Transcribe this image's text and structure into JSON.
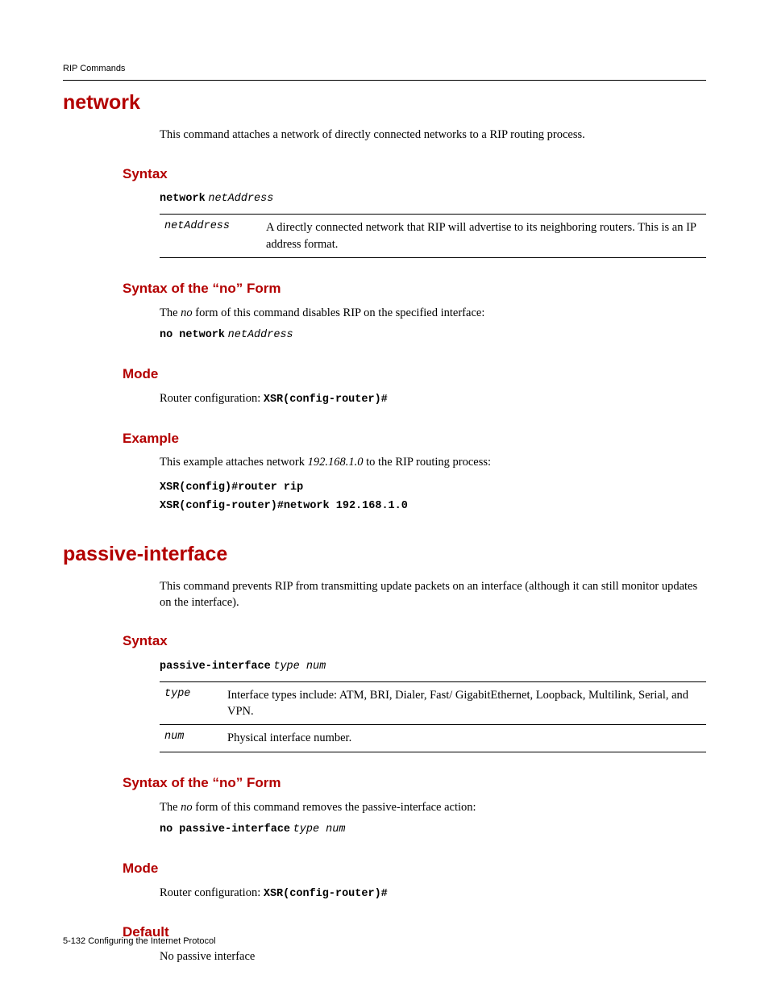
{
  "running_head": "RIP Commands",
  "section1": {
    "title": "network",
    "intro": "This command attaches a network of directly connected networks to a RIP routing process.",
    "syntax_h": "Syntax",
    "syntax_cmd": "network",
    "syntax_arg": "netAddress",
    "param_key": "netAddress",
    "param_desc": "A directly connected network that RIP will advertise to its neighboring routers. This is an IP address format.",
    "noform_h": "Syntax of the “no” Form",
    "noform_lead1": "The ",
    "noform_em": "no",
    "noform_lead2": " form of this command disables RIP on the specified interface:",
    "noform_cmd": "no network",
    "noform_arg": "netAddress",
    "mode_h": "Mode",
    "mode_lead": "Router configuration: ",
    "mode_code": "XSR(config-router)#",
    "example_h": "Example",
    "example_lead1": "This example attaches network ",
    "example_em": "192.168.1.0",
    "example_lead2": " to the RIP routing process:",
    "example_code1": "XSR(config)#router rip",
    "example_code2": "XSR(config-router)#network 192.168.1.0"
  },
  "section2": {
    "title": "passive-interface",
    "intro": "This command prevents RIP from transmitting update packets on an interface (although it can still monitor updates on the interface).",
    "syntax_h": "Syntax",
    "syntax_cmd": "passive-interface",
    "syntax_arg": "type num",
    "param1_key": "type",
    "param1_desc": "Interface types include: ATM, BRI, Dialer, Fast/ GigabitEthernet, Loopback, Multilink, Serial, and VPN.",
    "param2_key": "num",
    "param2_desc": "Physical interface number.",
    "noform_h": "Syntax of the “no” Form",
    "noform_lead1": "The ",
    "noform_em": "no",
    "noform_lead2": " form of this command removes the passive-interface action:",
    "noform_cmd": "no passive-interface",
    "noform_arg": "type num",
    "mode_h": "Mode",
    "mode_lead": "Router configuration: ",
    "mode_code": "XSR(config-router)#",
    "default_h": "Default",
    "default_body": "No passive interface"
  },
  "footer": "5-132   Configuring the Internet Protocol"
}
